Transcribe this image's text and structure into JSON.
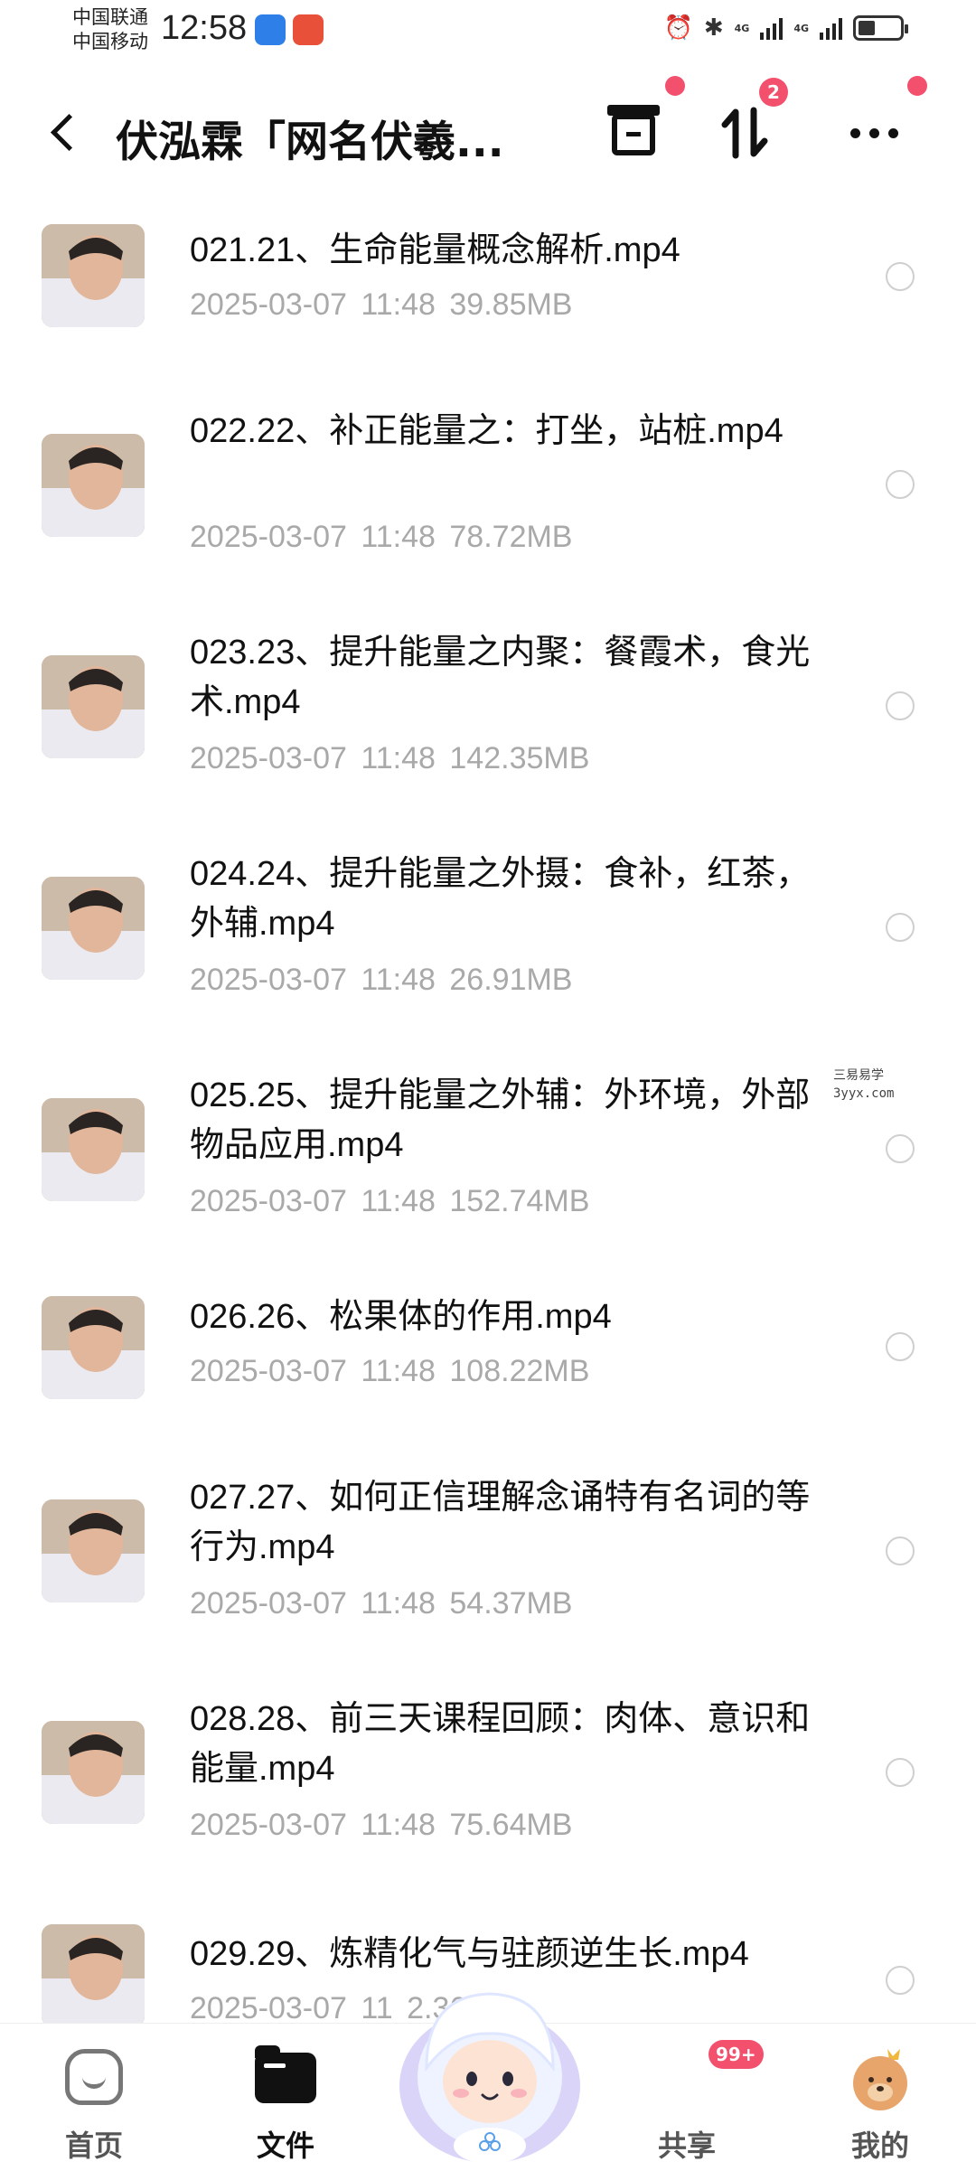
{
  "status_bar": {
    "carrier1": "中国联通",
    "carrier2": "中国移动",
    "time": "12:58",
    "network1": "4G",
    "network2": "4G"
  },
  "header": {
    "title": "伏泓霖「网名伏羲...",
    "transfer_badge": "2",
    "accent_color": "#f2506c"
  },
  "files": [
    {
      "name": "021.21、生命能量概念解析.mp4",
      "date": "2025-03-07",
      "time": "11:48",
      "size": "39.85MB"
    },
    {
      "name": "022.22、补正能量之：打坐，站桩.mp4",
      "date": "2025-03-07",
      "time": "11:48",
      "size": "78.72MB"
    },
    {
      "name": "023.23、提升能量之内聚：餐霞术，食光术.mp4",
      "date": "2025-03-07",
      "time": "11:48",
      "size": "142.35MB"
    },
    {
      "name": "024.24、提升能量之外摄：食补，红茶，外辅.mp4",
      "date": "2025-03-07",
      "time": "11:48",
      "size": "26.91MB"
    },
    {
      "name": "025.25、提升能量之外辅：外环境，外部物品应用.mp4",
      "date": "2025-03-07",
      "time": "11:48",
      "size": "152.74MB"
    },
    {
      "name": "026.26、松果体的作用.mp4",
      "date": "2025-03-07",
      "time": "11:48",
      "size": "108.22MB"
    },
    {
      "name": "027.27、如何正信理解念诵特有名词的等行为.mp4",
      "date": "2025-03-07",
      "time": "11:48",
      "size": "54.37MB"
    },
    {
      "name": "028.28、前三天课程回顾：肉体、意识和能量.mp4",
      "date": "2025-03-07",
      "time": "11:48",
      "size": "75.64MB"
    },
    {
      "name": "029.29、炼精化气与驻颜逆生长.mp4",
      "date": "2025-03-07",
      "time": "11",
      "size": "2.36MB"
    }
  ],
  "watermark": {
    "line1": "三易易学",
    "line2": "3yyx.com"
  },
  "tabs": [
    {
      "label": "首页",
      "icon": "home-icon"
    },
    {
      "label": "文件",
      "icon": "folder-icon"
    },
    {
      "label": "",
      "icon": "mascot-icon"
    },
    {
      "label": "共享",
      "icon": "send-icon",
      "badge": "99+"
    },
    {
      "label": "我的",
      "icon": "avatar-icon"
    }
  ]
}
